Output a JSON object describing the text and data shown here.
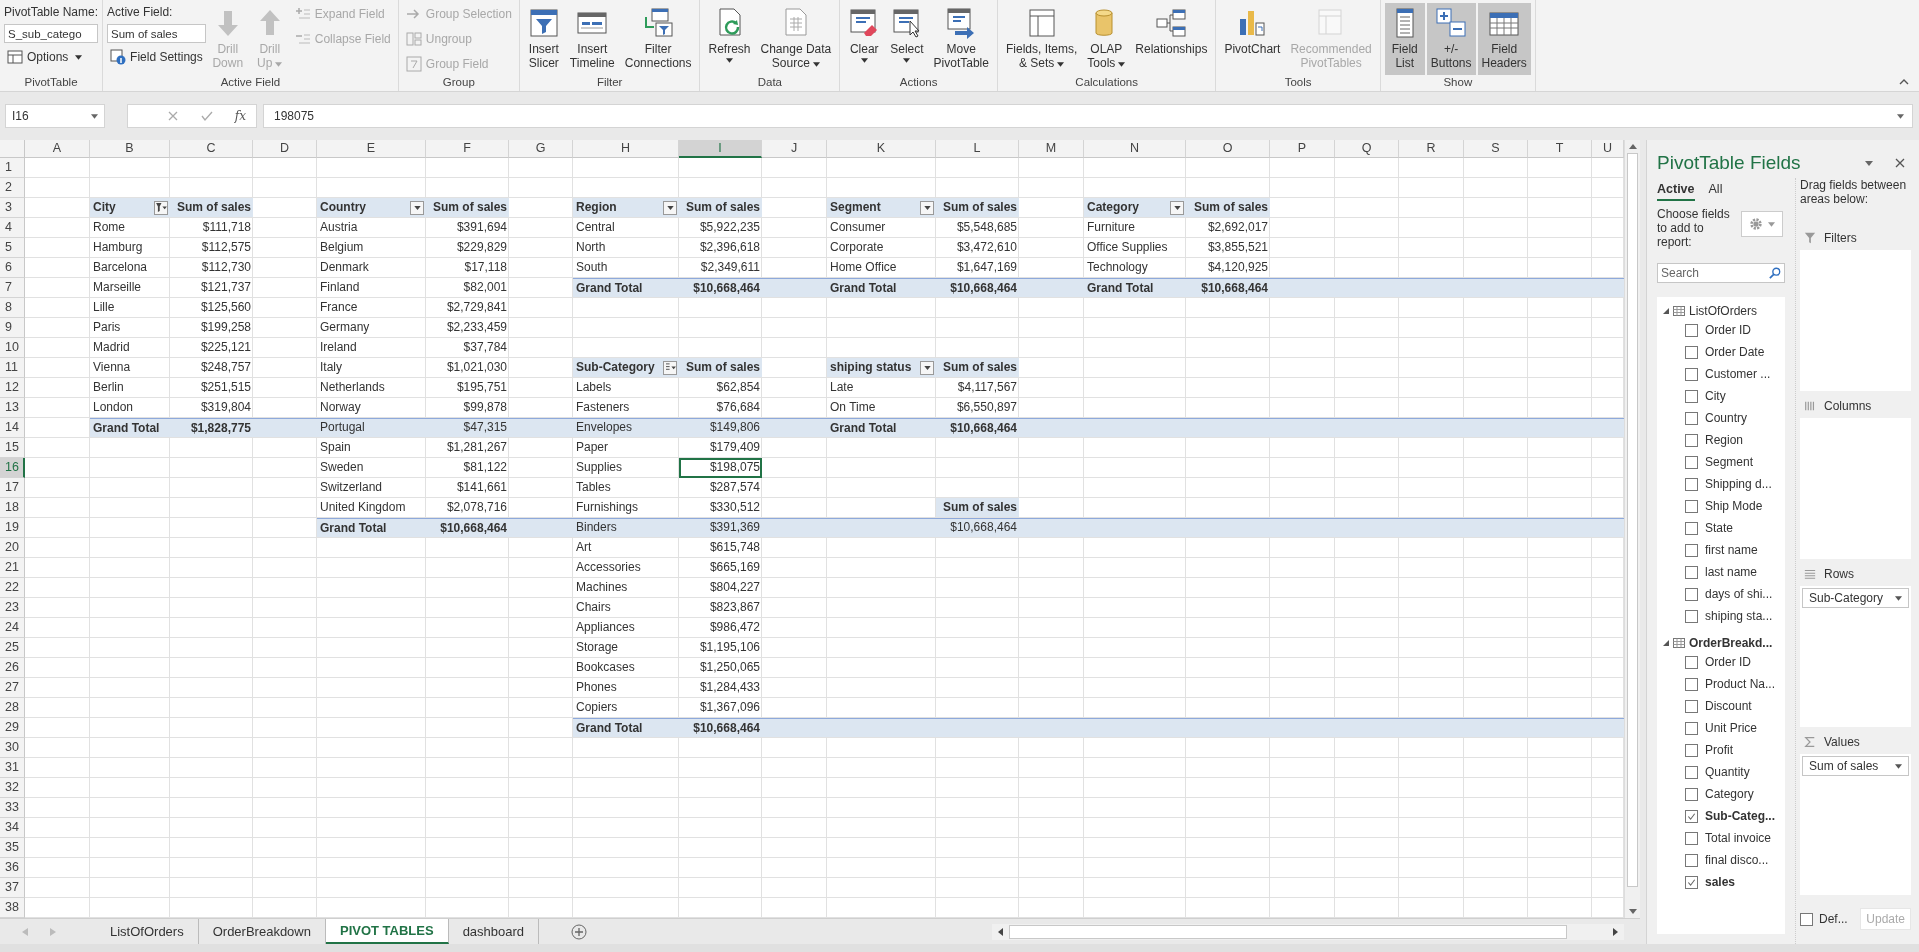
{
  "ribbon": {
    "groups": [
      {
        "label": "PivotTable",
        "columns": [
          [
            {
              "kind": "caption",
              "label": "PivotTable Name:"
            },
            {
              "kind": "field",
              "value": "S_sub_catego"
            },
            {
              "kind": "small",
              "label": "Options",
              "caret": true,
              "disabled": false
            }
          ]
        ]
      },
      {
        "label": "Active Field",
        "columns": [
          [
            {
              "kind": "caption",
              "label": "Active Field:"
            },
            {
              "kind": "field",
              "value": "Sum of sales"
            },
            {
              "kind": "small",
              "label": "Field Settings",
              "disabled": false
            }
          ],
          [
            {
              "kind": "large",
              "lines": [
                "Drill",
                "Down"
              ],
              "disabled": true,
              "selected": false
            }
          ],
          [
            {
              "kind": "large",
              "lines": [
                "Drill",
                "Up"
              ],
              "caret": true,
              "disabled": true,
              "selected": false
            }
          ],
          [
            {
              "kind": "small",
              "label": "Expand Field",
              "disabled": true
            },
            {
              "kind": "small",
              "label": "Collapse Field",
              "disabled": true
            }
          ]
        ]
      },
      {
        "label": "Group",
        "columns": [
          [
            {
              "kind": "small",
              "label": "Group Selection",
              "disabled": true
            },
            {
              "kind": "small",
              "label": "Ungroup",
              "disabled": true
            },
            {
              "kind": "small",
              "label": "Group Field",
              "disabled": true
            }
          ]
        ]
      },
      {
        "label": "Filter",
        "columns": [
          [
            {
              "kind": "large",
              "lines": [
                "Insert",
                "Slicer"
              ],
              "disabled": false,
              "selected": false
            }
          ],
          [
            {
              "kind": "large",
              "lines": [
                "Insert",
                "Timeline"
              ],
              "disabled": false,
              "selected": false
            }
          ],
          [
            {
              "kind": "large",
              "lines": [
                "Filter",
                "Connections"
              ],
              "disabled": false,
              "selected": false
            }
          ]
        ]
      },
      {
        "label": "Data",
        "columns": [
          [
            {
              "kind": "large",
              "lines": [
                "Refresh"
              ],
              "caret": true,
              "disabled": false,
              "selected": false
            }
          ],
          [
            {
              "kind": "large",
              "lines": [
                "Change Data",
                "Source"
              ],
              "caret": true,
              "disabled": false,
              "selected": false
            }
          ]
        ]
      },
      {
        "label": "Actions",
        "columns": [
          [
            {
              "kind": "large",
              "lines": [
                "Clear"
              ],
              "caret": true,
              "disabled": false,
              "selected": false
            }
          ],
          [
            {
              "kind": "large",
              "lines": [
                "Select"
              ],
              "caret": true,
              "disabled": false,
              "selected": false
            }
          ],
          [
            {
              "kind": "large",
              "lines": [
                "Move",
                "PivotTable"
              ],
              "disabled": false,
              "selected": false
            }
          ]
        ]
      },
      {
        "label": "Calculations",
        "columns": [
          [
            {
              "kind": "large",
              "lines": [
                "Fields, Items,",
                "& Sets"
              ],
              "caret": true,
              "disabled": false,
              "selected": false
            }
          ],
          [
            {
              "kind": "large",
              "lines": [
                "OLAP",
                "Tools"
              ],
              "caret": true,
              "disabled": false,
              "selected": false
            }
          ],
          [
            {
              "kind": "large",
              "lines": [
                "Relationships"
              ],
              "disabled": false,
              "selected": false
            }
          ]
        ]
      },
      {
        "label": "Tools",
        "columns": [
          [
            {
              "kind": "large",
              "lines": [
                "PivotChart"
              ],
              "disabled": false,
              "selected": false
            }
          ],
          [
            {
              "kind": "large",
              "lines": [
                "Recommended",
                "PivotTables"
              ],
              "disabled": true,
              "selected": false
            }
          ]
        ]
      },
      {
        "label": "Show",
        "columns": [
          [
            {
              "kind": "large",
              "lines": [
                "Field",
                "List"
              ],
              "disabled": false,
              "selected": true
            }
          ],
          [
            {
              "kind": "large",
              "lines": [
                "+/-",
                "Buttons"
              ],
              "disabled": false,
              "selected": true
            }
          ],
          [
            {
              "kind": "large",
              "lines": [
                "Field",
                "Headers"
              ],
              "disabled": false,
              "selected": true
            }
          ]
        ]
      }
    ]
  },
  "formula_bar": {
    "name_box": "I16",
    "function_label": "fx",
    "value": "198075"
  },
  "sheet": {
    "columns": [
      "A",
      "B",
      "C",
      "D",
      "E",
      "F",
      "G",
      "H",
      "I",
      "J",
      "K",
      "L",
      "M",
      "N",
      "O",
      "P",
      "Q",
      "R",
      "S",
      "T",
      "U"
    ],
    "rows": [
      "1",
      "2",
      "3",
      "4",
      "5",
      "6",
      "7",
      "8",
      "9",
      "10",
      "11",
      "12",
      "13",
      "14",
      "15",
      "16",
      "17",
      "18",
      "19",
      "20",
      "21",
      "22",
      "23",
      "24",
      "25",
      "26",
      "27",
      "28",
      "29",
      "30",
      "31",
      "32",
      "33",
      "34",
      "35",
      "36",
      "37",
      "38"
    ]
  },
  "pivots": [
    {
      "kind": "filtered",
      "header": [
        "City",
        "Sum of sales"
      ],
      "rows": [
        {
          "label": "Rome",
          "value": "$111,718",
          "selected": false
        },
        {
          "label": "Hamburg",
          "value": "$112,575",
          "selected": false
        },
        {
          "label": "Barcelona",
          "value": "$112,730",
          "selected": false
        },
        {
          "label": "Marseille",
          "value": "$121,737",
          "selected": false
        },
        {
          "label": "Lille",
          "value": "$125,560",
          "selected": false
        },
        {
          "label": "Paris",
          "value": "$199,258",
          "selected": false
        },
        {
          "label": "Madrid",
          "value": "$225,121",
          "selected": false
        },
        {
          "label": "Vienna",
          "value": "$248,757",
          "selected": false
        },
        {
          "label": "Berlin",
          "value": "$251,515",
          "selected": false
        },
        {
          "label": "London",
          "value": "$319,804",
          "selected": false
        }
      ],
      "total": {
        "label": "Grand Total",
        "value": "$1,828,775"
      }
    },
    {
      "kind": "plain",
      "header": [
        "Country",
        "Sum of sales"
      ],
      "rows": [
        {
          "label": "Austria",
          "value": "$391,694",
          "selected": false
        },
        {
          "label": "Belgium",
          "value": "$229,829",
          "selected": false
        },
        {
          "label": "Denmark",
          "value": "$17,118",
          "selected": false
        },
        {
          "label": "Finland",
          "value": "$82,001",
          "selected": false
        },
        {
          "label": "France",
          "value": "$2,729,841",
          "selected": false
        },
        {
          "label": "Germany",
          "value": "$2,233,459",
          "selected": false
        },
        {
          "label": "Ireland",
          "value": "$37,784",
          "selected": false
        },
        {
          "label": "Italy",
          "value": "$1,021,030",
          "selected": false
        },
        {
          "label": "Netherlands",
          "value": "$195,751",
          "selected": false
        },
        {
          "label": "Norway",
          "value": "$99,878",
          "selected": false
        },
        {
          "label": "Portugal",
          "value": "$47,315",
          "selected": false
        },
        {
          "label": "Spain",
          "value": "$1,281,267",
          "selected": false
        },
        {
          "label": "Sweden",
          "value": "$81,122",
          "selected": false
        },
        {
          "label": "Switzerland",
          "value": "$141,661",
          "selected": false
        },
        {
          "label": "United Kingdom",
          "value": "$2,078,716",
          "selected": false
        }
      ],
      "total": {
        "label": "Grand Total",
        "value": "$10,668,464"
      }
    },
    {
      "kind": "plain",
      "header": [
        "Region",
        "Sum of sales"
      ],
      "rows": [
        {
          "label": "Central",
          "value": "$5,922,235",
          "selected": false
        },
        {
          "label": "North",
          "value": "$2,396,618",
          "selected": false
        },
        {
          "label": "South",
          "value": "$2,349,611",
          "selected": false
        }
      ],
      "total": {
        "label": "Grand Total",
        "value": "$10,668,464"
      }
    },
    {
      "kind": "plain",
      "header": [
        "Segment",
        "Sum of sales"
      ],
      "rows": [
        {
          "label": "Consumer",
          "value": "$5,548,685",
          "selected": false
        },
        {
          "label": "Corporate",
          "value": "$3,472,610",
          "selected": false
        },
        {
          "label": "Home Office",
          "value": "$1,647,169",
          "selected": false
        }
      ],
      "total": {
        "label": "Grand Total",
        "value": "$10,668,464"
      }
    },
    {
      "kind": "plain",
      "header": [
        "Category",
        "Sum of sales"
      ],
      "rows": [
        {
          "label": "Furniture",
          "value": "$2,692,017",
          "selected": false
        },
        {
          "label": "Office Supplies",
          "value": "$3,855,521",
          "selected": false
        },
        {
          "label": "Technology",
          "value": "$4,120,925",
          "selected": false
        }
      ],
      "total": {
        "label": "Grand Total",
        "value": "$10,668,464"
      }
    },
    {
      "kind": "sorted",
      "header": [
        "Sub-Category",
        "Sum of sales"
      ],
      "rows": [
        {
          "label": "Labels",
          "value": "$62,854",
          "selected": false
        },
        {
          "label": "Fasteners",
          "value": "$76,684",
          "selected": false
        },
        {
          "label": "Envelopes",
          "value": "$149,806",
          "selected": false
        },
        {
          "label": "Paper",
          "value": "$179,409",
          "selected": false
        },
        {
          "label": "Supplies",
          "value": "$198,075",
          "selected": true
        },
        {
          "label": "Tables",
          "value": "$287,574",
          "selected": false
        },
        {
          "label": "Furnishings",
          "value": "$330,512",
          "selected": false
        },
        {
          "label": "Binders",
          "value": "$391,369",
          "selected": false
        },
        {
          "label": "Art",
          "value": "$615,748",
          "selected": false
        },
        {
          "label": "Accessories",
          "value": "$665,169",
          "selected": false
        },
        {
          "label": "Machines",
          "value": "$804,227",
          "selected": false
        },
        {
          "label": "Chairs",
          "value": "$823,867",
          "selected": false
        },
        {
          "label": "Appliances",
          "value": "$986,472",
          "selected": false
        },
        {
          "label": "Storage",
          "value": "$1,195,106",
          "selected": false
        },
        {
          "label": "Bookcases",
          "value": "$1,250,065",
          "selected": false
        },
        {
          "label": "Phones",
          "value": "$1,284,433",
          "selected": false
        },
        {
          "label": "Copiers",
          "value": "$1,367,096",
          "selected": false
        }
      ],
      "total": {
        "label": "Grand Total",
        "value": "$10,668,464"
      }
    },
    {
      "kind": "plain",
      "header": [
        "shiping status",
        "Sum of sales"
      ],
      "rows": [
        {
          "label": "Late",
          "value": "$4,117,567",
          "selected": false
        },
        {
          "label": "On Time",
          "value": "$6,550,897",
          "selected": false
        }
      ],
      "total": {
        "label": "Grand Total",
        "value": "$10,668,464"
      }
    },
    {
      "kind": "values",
      "header": [
        "Sum of sales"
      ],
      "rows": [
        {
          "value": "$10,668,464",
          "selected": false
        }
      ]
    }
  ],
  "sheet_tabs": [
    {
      "label": "ListOfOrders",
      "selected": false
    },
    {
      "label": "OrderBreakdown",
      "selected": false
    },
    {
      "label": "PIVOT TABLES",
      "selected": true
    },
    {
      "label": "dashboard",
      "selected": false
    }
  ],
  "field_pane": {
    "title": "PivotTable Fields",
    "tabs": [
      {
        "label": "Active",
        "selected": true
      },
      {
        "label": "All",
        "selected": false
      }
    ],
    "instruction": "Choose fields to add to report:",
    "search": {
      "placeholder": "Search"
    },
    "tables": [
      {
        "name": "ListOfOrders",
        "expanded": true,
        "fields": [
          {
            "label": "Order ID",
            "checked": false
          },
          {
            "label": "Order Date",
            "checked": false
          },
          {
            "label": "Customer ...",
            "checked": false
          },
          {
            "label": "City",
            "checked": false
          },
          {
            "label": "Country",
            "checked": false
          },
          {
            "label": "Region",
            "checked": false
          },
          {
            "label": "Segment",
            "checked": false
          },
          {
            "label": "Shipping d...",
            "checked": false
          },
          {
            "label": "Ship Mode",
            "checked": false
          },
          {
            "label": "State",
            "checked": false
          },
          {
            "label": "first name",
            "checked": false
          },
          {
            "label": "last name",
            "checked": false
          },
          {
            "label": "days of shi...",
            "checked": false
          },
          {
            "label": "shiping sta...",
            "checked": false
          }
        ]
      },
      {
        "name": "OrderBreakd...",
        "expanded": true,
        "fields": [
          {
            "label": "Order ID",
            "checked": false
          },
          {
            "label": "Product Na...",
            "checked": false
          },
          {
            "label": "Discount",
            "checked": false
          },
          {
            "label": "Unit Price",
            "checked": false
          },
          {
            "label": "Profit",
            "checked": false
          },
          {
            "label": "Quantity",
            "checked": false
          },
          {
            "label": "Category",
            "checked": false
          },
          {
            "label": "Sub-Categ...",
            "checked": true
          },
          {
            "label": "Total invoice",
            "checked": false
          },
          {
            "label": "final disco...",
            "checked": false
          },
          {
            "label": "sales",
            "checked": true
          }
        ]
      }
    ],
    "areas_hint": "Drag fields between areas below:",
    "areas": [
      {
        "kind": "filters",
        "label": "Filters"
      },
      {
        "kind": "columns",
        "label": "Columns"
      },
      {
        "kind": "rows",
        "label": "Rows",
        "items": [
          "Sub-Category"
        ]
      },
      {
        "kind": "values",
        "label": "Values",
        "items": [
          "Sum of sales"
        ]
      }
    ],
    "defer": {
      "label": "Def...",
      "checked": false
    },
    "update": {
      "label": "Update",
      "disabled": true
    }
  }
}
